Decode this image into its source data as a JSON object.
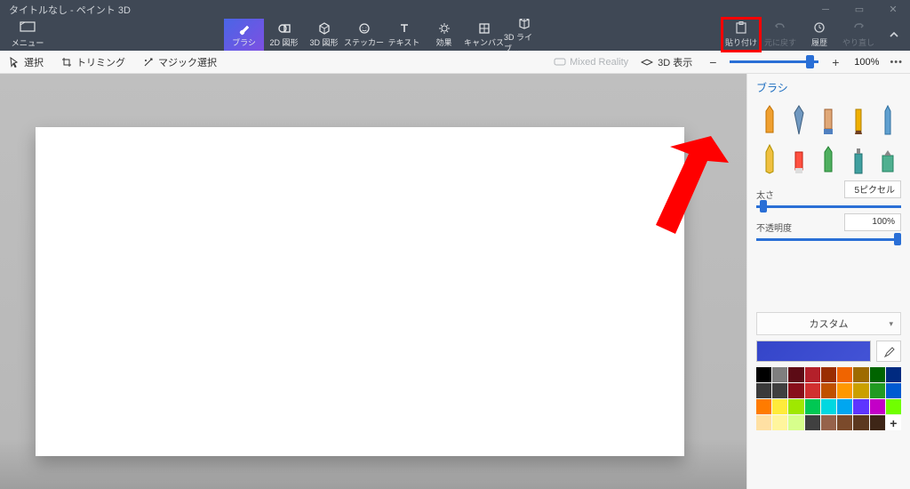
{
  "app": {
    "title": "タイトルなし - ペイント 3D"
  },
  "menu": {
    "label": "メニュー"
  },
  "tools": [
    {
      "id": "brush",
      "label": "ブラシ",
      "selected": true
    },
    {
      "id": "2d",
      "label": "2D 図形",
      "selected": false
    },
    {
      "id": "3d",
      "label": "3D 図形",
      "selected": false
    },
    {
      "id": "sticker",
      "label": "ステッカー",
      "selected": false
    },
    {
      "id": "text",
      "label": "テキスト",
      "selected": false
    },
    {
      "id": "fx",
      "label": "効果",
      "selected": false
    },
    {
      "id": "canvas",
      "label": "キャンバス",
      "selected": false
    },
    {
      "id": "3dlib",
      "label": "3D ライブ...",
      "selected": false
    }
  ],
  "actions": {
    "paste": "貼り付け",
    "undo": "元に戻す",
    "history": "履歴",
    "redo": "やり直し"
  },
  "secbar": {
    "select": "選択",
    "trim": "トリミング",
    "magic": "マジック選択",
    "mixed": "Mixed Reality",
    "view3d": "3D 表示",
    "zoom": "100%"
  },
  "side": {
    "title": "ブラシ",
    "thickness_label": "太さ",
    "thickness_value": "5ピクセル",
    "opacity_label": "不透明度",
    "opacity_value": "100%",
    "custom_label": "カスタム"
  },
  "palette": [
    "#000000",
    "#7f7f7f",
    "#5c0b15",
    "#b4202a",
    "#9a2d00",
    "#f06400",
    "#9e6b00",
    "#006400",
    "#002a80",
    "#3a3a3a",
    "#404040",
    "#880e1a",
    "#d12f2f",
    "#c05000",
    "#ff9800",
    "#caa000",
    "#219a21",
    "#005ad1",
    "#ff7b00",
    "#ffeb3b",
    "#9fe800",
    "#00c853",
    "#00d8e0",
    "#00a6f0",
    "#5e35ff",
    "#c300c7",
    "#70ff00",
    "#ffe0a3",
    "#fff59d",
    "#d7ff8c",
    "#404040",
    "#96624b",
    "#7b4a2b",
    "#5c381f",
    "#3e2617",
    "#+"
  ]
}
